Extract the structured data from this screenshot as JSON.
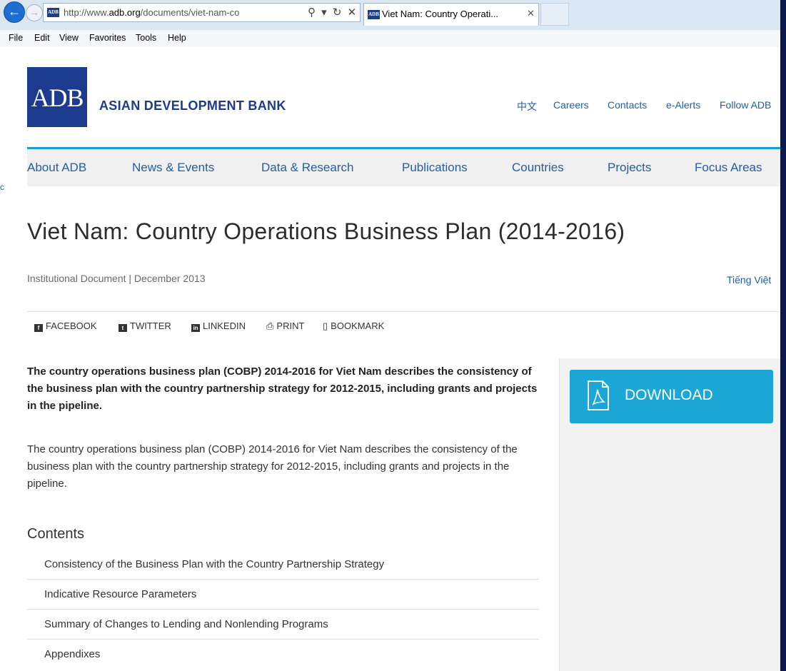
{
  "browser": {
    "url_prefix": "http://www.",
    "url_domain": "adb.org",
    "url_rest": "/documents/viet-nam-co",
    "favicon_text": "ADB",
    "address_icons": "⚲ ▾ ↻ ✕",
    "tab_title": "Viet Nam: Country Operati...",
    "tab_close": "✕"
  },
  "menu": [
    "File",
    "Edit",
    "View",
    "Favorites",
    "Tools",
    "Help"
  ],
  "header": {
    "logo_text": "ADB",
    "org_name": "ASIAN DEVELOPMENT BANK",
    "links": [
      "中文",
      "Careers",
      "Contacts",
      "e-Alerts",
      "Follow ADB"
    ]
  },
  "nav": [
    "About ADB",
    "News & Events",
    "Data & Research",
    "Publications",
    "Countries",
    "Projects",
    "Focus Areas"
  ],
  "stray_text": "c",
  "page": {
    "title": "Viet Nam: Country Operations Business Plan (2014-2016)",
    "meta": "Institutional Document | December 2013",
    "language_link": "Tiếng Việt"
  },
  "share": [
    {
      "label": "FACEBOOK",
      "icon": "facebook-icon"
    },
    {
      "label": "TWITTER",
      "icon": "twitter-icon"
    },
    {
      "label": "LINKEDIN",
      "icon": "linkedin-icon"
    },
    {
      "label": "PRINT",
      "icon": "print-icon"
    },
    {
      "label": "BOOKMARK",
      "icon": "bookmark-icon"
    }
  ],
  "article": {
    "lead": "The country operations business plan (COBP) 2014-2016 for Viet Nam describes the consistency of the business plan with the country partnership strategy for 2012-2015, including grants and projects in the pipeline.",
    "body": "The country operations business plan (COBP) 2014-2016 for Viet Nam describes the consistency of the business plan with the country partnership strategy for 2012-2015, including grants and projects in the pipeline.",
    "contents_heading": "Contents",
    "contents": [
      "Consistency of the Business Plan with the Country Partnership Strategy",
      "Indicative Resource Parameters",
      "Summary of Changes to Lending and Nonlending Programs",
      "Appendixes"
    ]
  },
  "sidebar": {
    "download_label": "DOWNLOAD",
    "download_icon": "pdf-icon"
  },
  "colors": {
    "brand": "#1c3b8e",
    "accent": "#1aa7d6",
    "link": "#1f5ea8"
  }
}
